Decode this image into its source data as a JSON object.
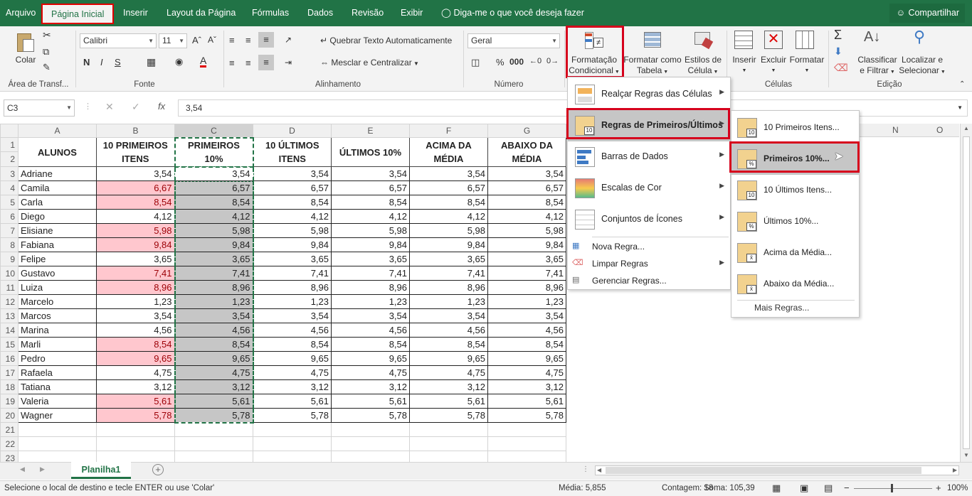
{
  "tabs": [
    "Arquivo",
    "Página Inicial",
    "Inserir",
    "Layout da Página",
    "Fórmulas",
    "Dados",
    "Revisão",
    "Exibir"
  ],
  "tell_me": "Diga-me o que você deseja fazer",
  "share": "Compartilhar",
  "ribbon": {
    "paste": "Colar",
    "clipboard_group": "Área de Transf...",
    "font_name": "Calibri",
    "font_size": "11",
    "font_group": "Fonte",
    "wrap": "Quebrar Texto Automaticamente",
    "merge": "Mesclar e Centralizar",
    "align_group": "Alinhamento",
    "number_format": "Geral",
    "number_group": "Número",
    "cond_fmt_1": "Formatação",
    "cond_fmt_2": "Condicional",
    "fmt_table_1": "Formatar como",
    "fmt_table_2": "Tabela",
    "cell_styles_1": "Estilos de",
    "cell_styles_2": "Célula",
    "insert": "Inserir",
    "delete": "Excluir",
    "format": "Formatar",
    "cells_group": "Células",
    "sort_1": "Classificar",
    "sort_2": "e Filtrar",
    "find_1": "Localizar e",
    "find_2": "Selecionar",
    "edit_group": "Edição"
  },
  "formula_bar": {
    "name_box": "C3",
    "fx": "fx",
    "value": "3,54"
  },
  "columns": [
    "A",
    "B",
    "C",
    "D",
    "E",
    "F",
    "G",
    "N",
    "O"
  ],
  "headers": [
    [
      "ALUNOS"
    ],
    [
      "10 PRIMEIROS",
      "ITENS"
    ],
    [
      "PRIMEIROS",
      "10%"
    ],
    [
      "10 ÚLTIMOS",
      "ITENS"
    ],
    [
      "ÚLTIMOS 10%"
    ],
    [
      "ACIMA DA",
      "MÉDIA"
    ],
    [
      "ABAIXO DA",
      "MÉDIA"
    ]
  ],
  "rows": [
    {
      "n": "3",
      "name": "Adriane",
      "b": "3,54",
      "c": "3,54",
      "hl": false
    },
    {
      "n": "4",
      "name": "Camila",
      "b": "6,67",
      "c": "6,57",
      "hl": true
    },
    {
      "n": "5",
      "name": "Carla",
      "b": "8,54",
      "c": "8,54",
      "hl": true
    },
    {
      "n": "6",
      "name": "Diego",
      "b": "4,12",
      "c": "4,12",
      "hl": false
    },
    {
      "n": "7",
      "name": "Elisiane",
      "b": "5,98",
      "c": "5,98",
      "hl": true
    },
    {
      "n": "8",
      "name": "Fabiana",
      "b": "9,84",
      "c": "9,84",
      "hl": true
    },
    {
      "n": "9",
      "name": "Felipe",
      "b": "3,65",
      "c": "3,65",
      "hl": false
    },
    {
      "n": "10",
      "name": "Gustavo",
      "b": "7,41",
      "c": "7,41",
      "hl": true
    },
    {
      "n": "11",
      "name": "Luiza",
      "b": "8,96",
      "c": "8,96",
      "hl": true
    },
    {
      "n": "12",
      "name": "Marcelo",
      "b": "1,23",
      "c": "1,23",
      "hl": false
    },
    {
      "n": "13",
      "name": "Marcos",
      "b": "3,54",
      "c": "3,54",
      "hl": false
    },
    {
      "n": "14",
      "name": "Marina",
      "b": "4,56",
      "c": "4,56",
      "hl": false
    },
    {
      "n": "15",
      "name": "Marli",
      "b": "8,54",
      "c": "8,54",
      "hl": true
    },
    {
      "n": "16",
      "name": "Pedro",
      "b": "9,65",
      "c": "9,65",
      "hl": true
    },
    {
      "n": "17",
      "name": "Rafaela",
      "b": "4,75",
      "c": "4,75",
      "hl": false
    },
    {
      "n": "18",
      "name": "Tatiana",
      "b": "3,12",
      "c": "3,12",
      "hl": false
    },
    {
      "n": "19",
      "name": "Valeria",
      "b": "5,61",
      "c": "5,61",
      "hl": true
    },
    {
      "n": "20",
      "name": "Wagner",
      "b": "5,78",
      "c": "5,78",
      "hl": true
    }
  ],
  "empty_rows": [
    "21",
    "22",
    "23"
  ],
  "menu": {
    "items": [
      "Realçar Regras das Células",
      "Regras de Primeiros/Últimos",
      "Barras de Dados",
      "Escalas de Cor",
      "Conjuntos de Ícones"
    ],
    "small": [
      "Nova Regra...",
      "Limpar Regras",
      "Gerenciar Regras..."
    ]
  },
  "submenu": {
    "items": [
      "10 Primeiros Itens...",
      "Primeiros 10%...",
      "10 Últimos Itens...",
      "Últimos 10%...",
      "Acima da Média...",
      "Abaixo da Média..."
    ],
    "more": "Mais Regras..."
  },
  "sheet_tab": "Planilha1",
  "status": {
    "message": "Selecione o local de destino e tecle ENTER ou use 'Colar'",
    "avg": "Média: 5,855",
    "count": "Contagem: 18",
    "sum": "Soma: 105,39",
    "zoom": "100%"
  },
  "colors": {
    "excel_green": "#217346",
    "highlight_fill": "#ffc7ce",
    "highlight_text": "#9c0006",
    "callout_red": "#d6001c"
  }
}
